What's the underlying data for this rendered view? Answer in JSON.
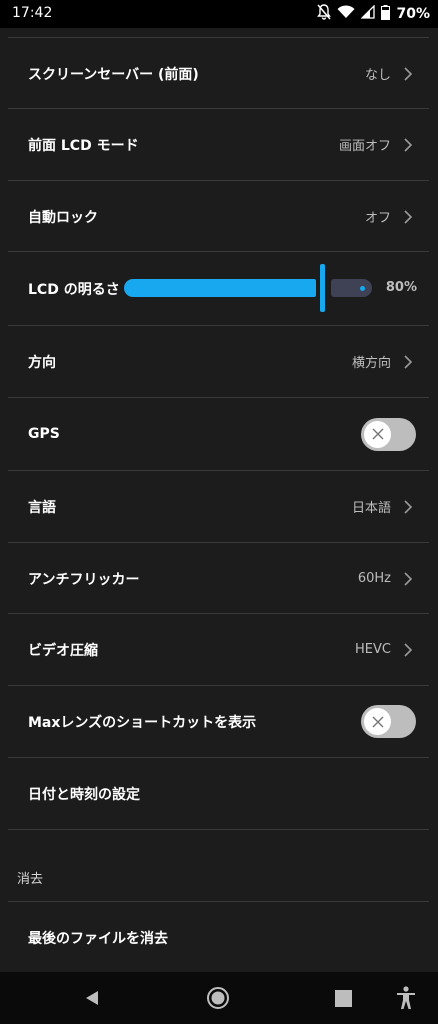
{
  "status_bar": {
    "time": "17:42",
    "battery": "70%",
    "icons": [
      "notifications-off-icon",
      "wifi-icon",
      "signal-icon",
      "battery-icon"
    ]
  },
  "settings": {
    "screensaver_front": {
      "label": "スクリーンセーバー (前面)",
      "value": "なし"
    },
    "front_lcd_mode": {
      "label": "前面 LCD モード",
      "value": "画面オフ"
    },
    "auto_lock": {
      "label": "自動ロック",
      "value": "オフ"
    },
    "lcd_brightness": {
      "label": "LCD の明るさ",
      "value": "80%",
      "level_percent": 80
    },
    "orientation": {
      "label": "方向",
      "value": "横方向"
    },
    "gps": {
      "label": "GPS",
      "enabled": false
    },
    "language": {
      "label": "言語",
      "value": "日本語"
    },
    "anti_flicker": {
      "label": "アンチフリッカー",
      "value": "60Hz"
    },
    "video_compression": {
      "label": "ビデオ圧縮",
      "value": "HEVC"
    },
    "max_lens_shortcut": {
      "label": "Maxレンズのショートカットを表示",
      "enabled": false
    },
    "date_time": {
      "label": "日付と時刻の設定"
    }
  },
  "delete_section": {
    "header": "消去",
    "delete_last_file": {
      "label": "最後のファイルを消去"
    }
  },
  "colors": {
    "background": "#1c1c1c",
    "accent": "#18a8f0",
    "toggle_off": "#bdbdbd"
  },
  "nav_bar": {
    "buttons": [
      "back-icon",
      "home-icon",
      "recents-icon",
      "accessibility-icon"
    ]
  }
}
